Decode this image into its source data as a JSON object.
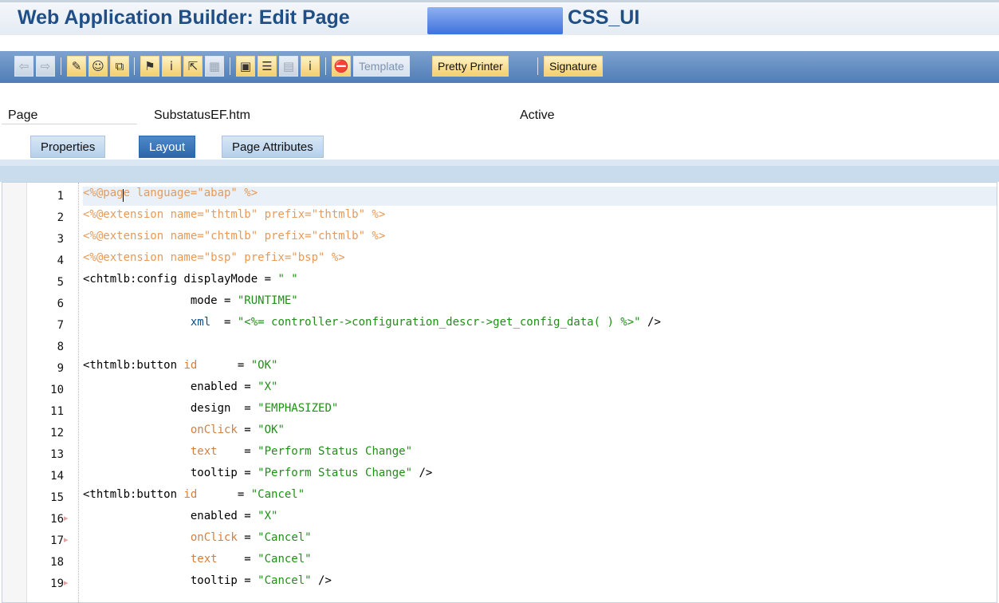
{
  "window": {
    "title_prefix": "Web Application Builder: Edit Page",
    "title_suffix": "CSS_UI"
  },
  "toolbar": {
    "buttons": [
      {
        "name": "back-icon",
        "label": "⇦",
        "interactable": false
      },
      {
        "name": "forward-icon",
        "label": "⇨",
        "interactable": false
      },
      {
        "name": "edit-icon",
        "label": "✎",
        "interactable": true
      },
      {
        "name": "check-icon",
        "label": "☺",
        "interactable": true
      },
      {
        "name": "pages-icon",
        "label": "⧉",
        "interactable": true
      },
      {
        "name": "object-icon",
        "label": "⚑",
        "interactable": true
      },
      {
        "name": "pin-icon",
        "label": "i",
        "interactable": true
      },
      {
        "name": "navigation-icon",
        "label": "⇱",
        "interactable": true
      },
      {
        "name": "grid-icon",
        "label": "▦",
        "interactable": false
      },
      {
        "name": "layout-icon",
        "label": "▣",
        "interactable": true
      },
      {
        "name": "list-icon",
        "label": "☰",
        "interactable": true
      },
      {
        "name": "table-icon",
        "label": "▤",
        "interactable": false
      },
      {
        "name": "info-icon",
        "label": "i",
        "interactable": true
      },
      {
        "name": "stop-icon",
        "label": "⛔",
        "interactable": true
      }
    ],
    "template_label": "Template",
    "pretty_printer_label": "Pretty Printer",
    "signature_label": "Signature"
  },
  "page_field": {
    "label": "Page",
    "value": "SubstatusEF.htm",
    "status": "Active"
  },
  "tabs": [
    {
      "label": "Properties",
      "active": false
    },
    {
      "label": "Layout",
      "active": true
    },
    {
      "label": "Page Attributes",
      "active": false
    }
  ],
  "code": {
    "lines": [
      {
        "num": "1",
        "segments": [
          {
            "cls": "tok-dir",
            "text": "<%@page language=\"abap\" %>"
          }
        ],
        "highlight": true
      },
      {
        "num": "2",
        "segments": [
          {
            "cls": "tok-dir",
            "text": "<%@extension name=\"thtmlb\" prefix=\"thtmlb\" %>"
          }
        ]
      },
      {
        "num": "3",
        "segments": [
          {
            "cls": "tok-dir",
            "text": "<%@extension name=\"chtmlb\" prefix=\"chtmlb\" %>"
          }
        ]
      },
      {
        "num": "4",
        "segments": [
          {
            "cls": "tok-dir",
            "text": "<%@extension name=\"bsp\" prefix=\"bsp\" %>"
          }
        ]
      },
      {
        "num": "5",
        "segments": [
          {
            "cls": "tok-tag",
            "text": "<chtmlb:config displayMode = "
          },
          {
            "cls": "tok-str",
            "text": "\" \""
          }
        ]
      },
      {
        "num": "6",
        "segments": [
          {
            "cls": "tok-tag",
            "text": "                mode = "
          },
          {
            "cls": "tok-str",
            "text": "\"RUNTIME\""
          }
        ]
      },
      {
        "num": "7",
        "segments": [
          {
            "cls": "tok-tag",
            "text": "                "
          },
          {
            "cls": "tok-attr",
            "text": "xml"
          },
          {
            "cls": "tok-tag",
            "text": "  = "
          },
          {
            "cls": "tok-str2",
            "text": "\"<%= controller->configuration_descr->get_config_data( ) %>\""
          },
          {
            "cls": "tok-tag",
            "text": " />"
          }
        ]
      },
      {
        "num": "8",
        "segments": [
          {
            "cls": "tok-tag",
            "text": ""
          }
        ]
      },
      {
        "num": "9",
        "segments": [
          {
            "cls": "tok-tag",
            "text": "<thtmlb:button "
          },
          {
            "cls": "tok-attr2",
            "text": "id"
          },
          {
            "cls": "tok-tag",
            "text": "      = "
          },
          {
            "cls": "tok-str",
            "text": "\"OK\""
          }
        ]
      },
      {
        "num": "10",
        "segments": [
          {
            "cls": "tok-tag",
            "text": "                enabled = "
          },
          {
            "cls": "tok-str",
            "text": "\"X\""
          }
        ]
      },
      {
        "num": "11",
        "segments": [
          {
            "cls": "tok-tag",
            "text": "                design  = "
          },
          {
            "cls": "tok-str",
            "text": "\"EMPHASIZED\""
          }
        ]
      },
      {
        "num": "12",
        "segments": [
          {
            "cls": "tok-tag",
            "text": "                "
          },
          {
            "cls": "tok-attr2",
            "text": "onClick"
          },
          {
            "cls": "tok-tag",
            "text": " = "
          },
          {
            "cls": "tok-str",
            "text": "\"OK\""
          }
        ]
      },
      {
        "num": "13",
        "segments": [
          {
            "cls": "tok-tag",
            "text": "                "
          },
          {
            "cls": "tok-attr2",
            "text": "text"
          },
          {
            "cls": "tok-tag",
            "text": "    = "
          },
          {
            "cls": "tok-str",
            "text": "\"Perform Status Change\""
          }
        ]
      },
      {
        "num": "14",
        "segments": [
          {
            "cls": "tok-tag",
            "text": "                tooltip = "
          },
          {
            "cls": "tok-str",
            "text": "\"Perform Status Change\""
          },
          {
            "cls": "tok-tag",
            "text": " />"
          }
        ]
      },
      {
        "num": "15",
        "segments": [
          {
            "cls": "tok-tag",
            "text": "<thtmlb:button "
          },
          {
            "cls": "tok-attr2",
            "text": "id"
          },
          {
            "cls": "tok-tag",
            "text": "      = "
          },
          {
            "cls": "tok-str",
            "text": "\"Cancel\""
          }
        ]
      },
      {
        "num": "16",
        "mark": true,
        "segments": [
          {
            "cls": "tok-tag",
            "text": "                enabled = "
          },
          {
            "cls": "tok-str",
            "text": "\"X\""
          }
        ]
      },
      {
        "num": "17",
        "mark": true,
        "segments": [
          {
            "cls": "tok-tag",
            "text": "                "
          },
          {
            "cls": "tok-attr2",
            "text": "onClick"
          },
          {
            "cls": "tok-tag",
            "text": " = "
          },
          {
            "cls": "tok-str",
            "text": "\"Cancel\""
          }
        ]
      },
      {
        "num": "18",
        "segments": [
          {
            "cls": "tok-tag",
            "text": "                "
          },
          {
            "cls": "tok-attr2",
            "text": "text"
          },
          {
            "cls": "tok-tag",
            "text": "    = "
          },
          {
            "cls": "tok-str",
            "text": "\"Cancel\""
          }
        ]
      },
      {
        "num": "19",
        "mark": true,
        "segments": [
          {
            "cls": "tok-tag",
            "text": "                tooltip = "
          },
          {
            "cls": "tok-str",
            "text": "\"Cancel\""
          },
          {
            "cls": "tok-tag",
            "text": " />"
          }
        ]
      }
    ]
  }
}
